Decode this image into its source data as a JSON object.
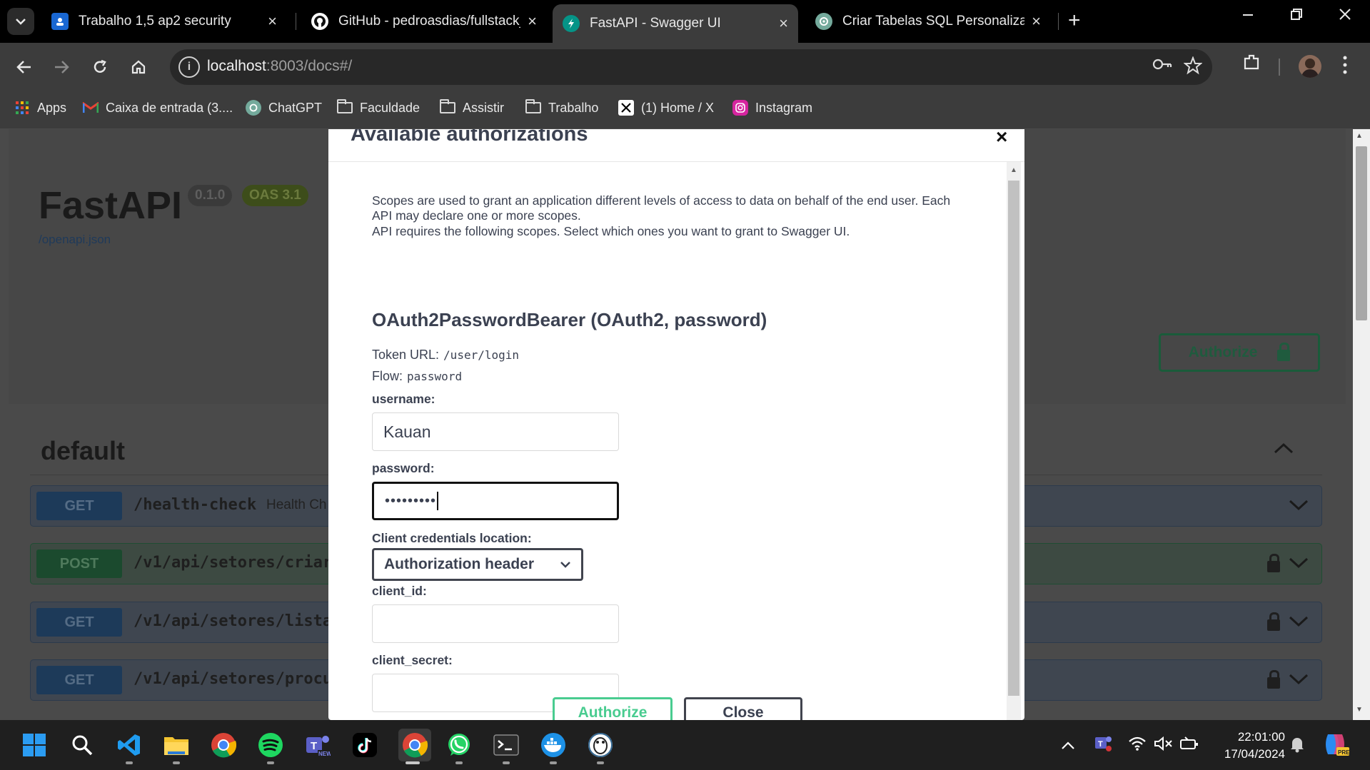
{
  "browser": {
    "tabs": [
      {
        "label": "Trabalho 1,5 ap2 security",
        "icon": "classroom-icon",
        "active": false
      },
      {
        "label": "GitHub - pedroasdias/fullstack_",
        "icon": "github-icon",
        "active": false
      },
      {
        "label": "FastAPI - Swagger UI",
        "icon": "fastapi-icon",
        "active": true
      },
      {
        "label": "Criar Tabelas SQL Personalizada",
        "icon": "chatgpt-icon",
        "active": false
      }
    ],
    "close_glyph": "×",
    "new_tab_glyph": "+",
    "url_host": "localhost",
    "url_rest": ":8003/docs#/",
    "bookmarks": [
      {
        "label": "Apps",
        "icon": "apps-grid-icon"
      },
      {
        "label": "Caixa de entrada (3....",
        "icon": "gmail-icon"
      },
      {
        "label": "ChatGPT",
        "icon": "chatgpt-icon"
      },
      {
        "label": "Faculdade",
        "icon": "folder-icon"
      },
      {
        "label": "Assistir",
        "icon": "folder-icon"
      },
      {
        "label": "Trabalho",
        "icon": "folder-icon"
      },
      {
        "label": "(1) Home / X",
        "icon": "x-icon"
      },
      {
        "label": "Instagram",
        "icon": "instagram-icon"
      }
    ]
  },
  "swagger": {
    "title": "FastAPI",
    "version_badge": "0.1.0",
    "oas_badge": "OAS 3.1",
    "spec_link": "/openapi.json",
    "authorize_label": "Authorize",
    "section_title": "default",
    "operations": [
      {
        "method": "GET",
        "path": "/health-check",
        "summary": "Health Ch",
        "locked": false
      },
      {
        "method": "POST",
        "path": "/v1/api/setores/criar",
        "summary": "",
        "locked": true
      },
      {
        "method": "GET",
        "path": "/v1/api/setores/lista",
        "summary": "",
        "locked": true
      },
      {
        "method": "GET",
        "path": "/v1/api/setores/procu",
        "summary": "",
        "locked": true
      }
    ]
  },
  "modal": {
    "title": "Available authorizations",
    "close_glyph": "×",
    "scopes_text_1": "Scopes are used to grant an application different levels of access to data on behalf of the end user. Each API may declare one or more scopes.",
    "scopes_text_2": "API requires the following scopes. Select which ones you want to grant to Swagger UI.",
    "scheme_title": "OAuth2PasswordBearer (OAuth2, password)",
    "token_url_label": "Token URL:",
    "token_url_value": "/user/login",
    "flow_label": "Flow:",
    "flow_value": "password",
    "username_label": "username:",
    "username_value": "Kauan",
    "password_label": "password:",
    "password_value": "•••••••••",
    "client_location_label": "Client credentials location:",
    "client_location_value": "Authorization header",
    "client_id_label": "client_id:",
    "client_id_value": "",
    "client_secret_label": "client_secret:",
    "client_secret_value": "",
    "authorize_button": "Authorize",
    "close_button": "Close"
  },
  "taskbar": {
    "time": "22:01:00",
    "date": "17/04/2024",
    "apps": [
      "windows-start-icon",
      "search-icon",
      "vscode-icon",
      "file-explorer-icon",
      "chrome-icon",
      "spotify-icon",
      "teams-icon",
      "tiktok-icon",
      "chrome-icon",
      "whatsapp-icon",
      "terminal-icon",
      "docker-icon",
      "pgadmin-icon"
    ]
  },
  "colors": {
    "authorize_green": "#49cc90",
    "get_blue": "#61affe",
    "post_green": "#49cc90",
    "text_dark": "#3b4151"
  }
}
